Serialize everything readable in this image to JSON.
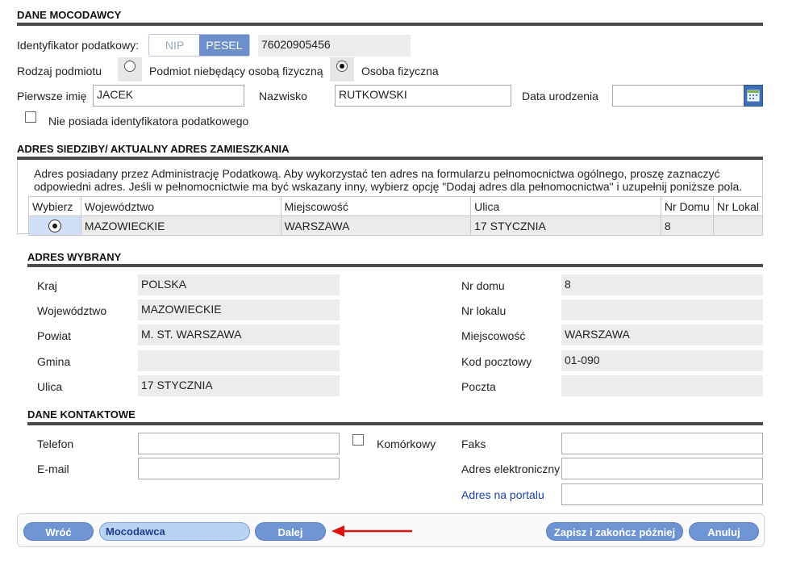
{
  "grantor": {
    "title": "DANE MOCODAWCY",
    "tax_id_label": "Identyfikator podatkowy:",
    "tax_id_options": [
      "NIP",
      "PESEL"
    ],
    "tax_id_selected": "PESEL",
    "tax_id_value": "76020905456",
    "entity_type_label": "Rodzaj podmiotu",
    "entity_option_legal": "Podmiot niebędący osobą fizyczną",
    "entity_option_person": "Osoba fizyczna",
    "entity_selected": "Osoba fizyczna",
    "first_name_label": "Pierwsze imię",
    "first_name_value": "JACEK",
    "last_name_label": "Nazwisko",
    "last_name_value": "RUTKOWSKI",
    "birth_date_label": "Data urodzenia",
    "birth_date_value": "",
    "no_tax_id_label": "Nie posiada identyfikatora podatkowego"
  },
  "address_section": {
    "title": "ADRES SIEDZIBY/ AKTUALNY ADRES ZAMIESZKANIA",
    "info_line1": "Adres posiadany przez Administrację Podatkową. Aby wykorzystać ten adres na formularzu pełnomocnictwa ogólnego, proszę zaznaczyć",
    "info_line2": "odpowiedni adres. Jeśli w pełnomocnictwie ma być wskazany inny, wybierz opcję \"Dodaj adres dla pełnomocnictwa\" i uzupełnij poniższe pola.",
    "columns": [
      "Wybierz",
      "Województwo",
      "Miejscowość",
      "Ulica",
      "Nr Domu",
      "Nr Lokal"
    ],
    "rows": [
      {
        "voivodeship": "MAZOWIECKIE",
        "city": "WARSZAWA",
        "street": "17 STYCZNIA",
        "house": "8",
        "flat": ""
      }
    ]
  },
  "selected_address": {
    "title": "ADRES WYBRANY",
    "left": [
      {
        "label": "Kraj",
        "value": "POLSKA"
      },
      {
        "label": "Województwo",
        "value": "MAZOWIECKIE"
      },
      {
        "label": "Powiat",
        "value": "M. ST. WARSZAWA"
      },
      {
        "label": "Gmina",
        "value": ""
      },
      {
        "label": "Ulica",
        "value": "17 STYCZNIA"
      }
    ],
    "right": [
      {
        "label": "Nr domu",
        "value": "8"
      },
      {
        "label": "Nr lokalu",
        "value": ""
      },
      {
        "label": "Miejscowość",
        "value": "WARSZAWA"
      },
      {
        "label": "Kod pocztowy",
        "value": "01-090"
      },
      {
        "label": "Poczta",
        "value": ""
      }
    ]
  },
  "contact": {
    "title": "DANE KONTAKTOWE",
    "phone_label": "Telefon",
    "mobile_label": "Komórkowy",
    "email_label": "E-mail",
    "fax_label": "Faks",
    "eaddress_label": "Adres elektroniczny",
    "portal_label": "Adres na portalu"
  },
  "footer": {
    "back": "Wróć",
    "step": "Mocodawca",
    "next": "Dalej",
    "save_later": "Zapisz i zakończ później",
    "cancel": "Anuluj"
  },
  "colors": {
    "button": "#6f94d3",
    "rule": "#4a4a4a",
    "arrow": "#e01010",
    "link": "#1a3fa8"
  }
}
